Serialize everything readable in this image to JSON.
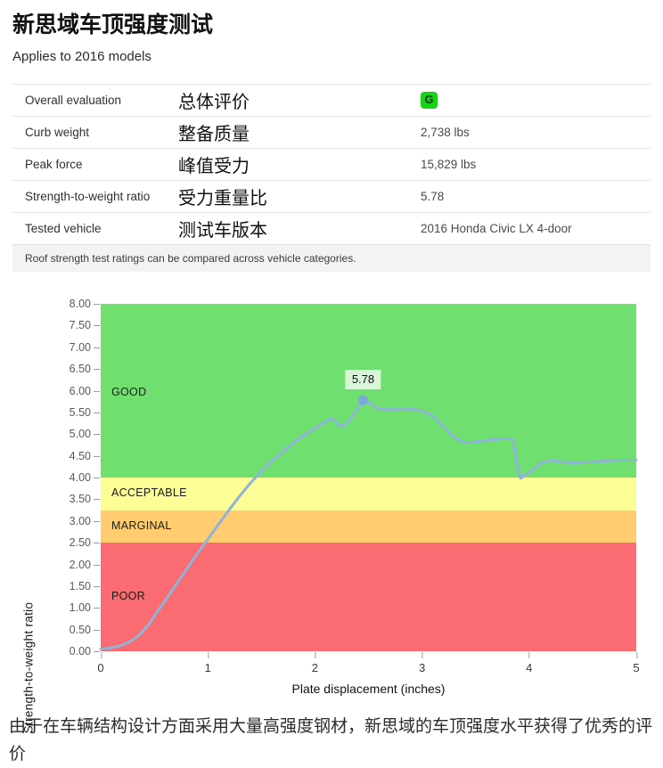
{
  "header": {
    "title": "新思域车顶强度测试",
    "subtitle": "Applies to 2016 models"
  },
  "spec_table": {
    "rows": [
      {
        "label": "Overall evaluation",
        "label_cn": "总体评价",
        "value": "",
        "badge": "G",
        "badge_color": "#17d317"
      },
      {
        "label": "Curb weight",
        "label_cn": "整备质量",
        "value": "2,738 lbs",
        "badge": ""
      },
      {
        "label": "Peak force",
        "label_cn": "峰值受力",
        "value": "15,829 lbs",
        "badge": ""
      },
      {
        "label": "Strength-to-weight ratio",
        "label_cn": "受力重量比",
        "value": "5.78",
        "badge": ""
      },
      {
        "label": "Tested vehicle",
        "label_cn": "测试车版本",
        "value": "2016 Honda Civic LX 4-door",
        "badge": ""
      }
    ],
    "note": "Roof strength test ratings can be compared across vehicle categories."
  },
  "chart_data": {
    "type": "line",
    "title": "",
    "xlabel": "Plate displacement (inches)",
    "ylabel": "Strength-to-weight ratio",
    "xlim": [
      0,
      5
    ],
    "ylim": [
      0,
      8
    ],
    "xticks": [
      "0",
      "1",
      "2",
      "3",
      "4",
      "5"
    ],
    "yticks": [
      "0.00",
      "0.50",
      "1.00",
      "1.50",
      "2.00",
      "2.50",
      "3.00",
      "3.50",
      "4.00",
      "4.50",
      "5.00",
      "5.50",
      "6.00",
      "6.50",
      "7.00",
      "7.50",
      "8.00"
    ],
    "grid": false,
    "legend": "none",
    "line_color": "#8fb4d9",
    "bands": [
      {
        "label": "POOR",
        "from": 0.0,
        "to": 2.5,
        "color": "#fa6b72"
      },
      {
        "label": "MARGINAL",
        "from": 2.5,
        "to": 3.25,
        "color": "#ffcc70"
      },
      {
        "label": "ACCEPTABLE",
        "from": 3.25,
        "to": 4.0,
        "color": "#fdfd96"
      },
      {
        "label": "GOOD",
        "from": 4.0,
        "to": 8.0,
        "color": "#6fe06f"
      }
    ],
    "annotation": {
      "text": "5.78",
      "x": 2.45,
      "y": 5.78
    },
    "series": [
      {
        "name": "Strength-to-weight ratio",
        "points": [
          [
            0.0,
            0.05
          ],
          [
            0.1,
            0.08
          ],
          [
            0.2,
            0.14
          ],
          [
            0.3,
            0.26
          ],
          [
            0.38,
            0.42
          ],
          [
            0.45,
            0.62
          ],
          [
            0.52,
            0.88
          ],
          [
            0.6,
            1.16
          ],
          [
            0.7,
            1.52
          ],
          [
            0.8,
            1.88
          ],
          [
            0.9,
            2.24
          ],
          [
            1.0,
            2.58
          ],
          [
            1.1,
            2.92
          ],
          [
            1.2,
            3.26
          ],
          [
            1.3,
            3.58
          ],
          [
            1.4,
            3.88
          ],
          [
            1.5,
            4.14
          ],
          [
            1.6,
            4.38
          ],
          [
            1.7,
            4.6
          ],
          [
            1.8,
            4.8
          ],
          [
            1.9,
            4.98
          ],
          [
            2.0,
            5.14
          ],
          [
            2.08,
            5.26
          ],
          [
            2.14,
            5.36
          ],
          [
            2.18,
            5.33
          ],
          [
            2.22,
            5.22
          ],
          [
            2.26,
            5.18
          ],
          [
            2.32,
            5.3
          ],
          [
            2.38,
            5.52
          ],
          [
            2.45,
            5.78
          ],
          [
            2.52,
            5.7
          ],
          [
            2.6,
            5.58
          ],
          [
            2.7,
            5.56
          ],
          [
            2.8,
            5.58
          ],
          [
            2.9,
            5.58
          ],
          [
            3.0,
            5.54
          ],
          [
            3.1,
            5.42
          ],
          [
            3.2,
            5.18
          ],
          [
            3.3,
            4.92
          ],
          [
            3.4,
            4.8
          ],
          [
            3.5,
            4.82
          ],
          [
            3.6,
            4.86
          ],
          [
            3.7,
            4.88
          ],
          [
            3.8,
            4.9
          ],
          [
            3.85,
            4.88
          ],
          [
            3.88,
            4.4
          ],
          [
            3.92,
            3.98
          ],
          [
            4.0,
            4.12
          ],
          [
            4.1,
            4.32
          ],
          [
            4.2,
            4.4
          ],
          [
            4.3,
            4.36
          ],
          [
            4.4,
            4.34
          ],
          [
            4.55,
            4.36
          ],
          [
            4.7,
            4.38
          ],
          [
            4.85,
            4.4
          ],
          [
            5.0,
            4.4
          ]
        ]
      }
    ]
  },
  "footer": {
    "text": "由于在车辆结构设计方面采用大量高强度钢材，新思域的车顶强度水平获得了优秀的评价"
  }
}
